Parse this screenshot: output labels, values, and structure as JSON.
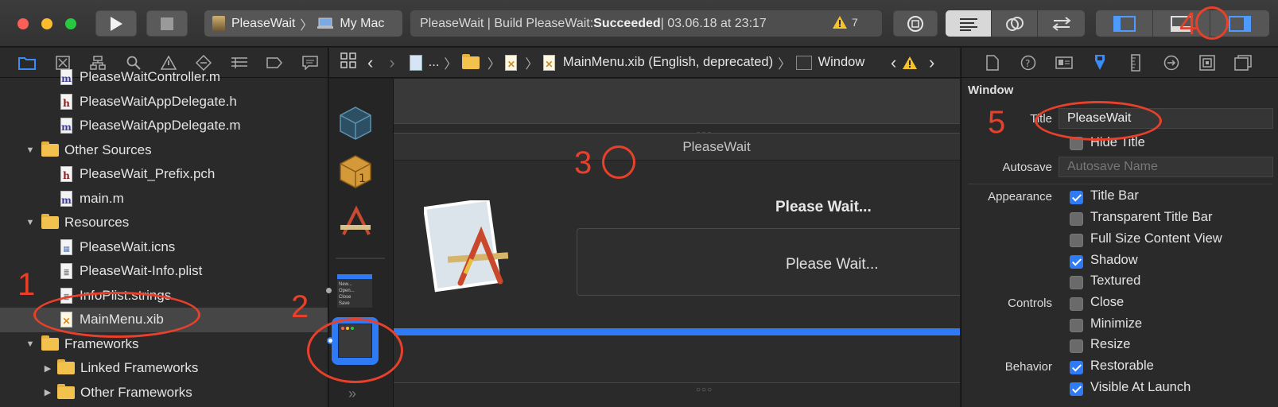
{
  "toolbar": {
    "scheme_target": "PleaseWait",
    "scheme_device": "My Mac",
    "activity_prefix": "PleaseWait | Build PleaseWait: ",
    "activity_status": "Succeeded",
    "activity_time": " | 03.06.18 at 23:17",
    "warning_count": "7"
  },
  "navigator": {
    "tree": [
      {
        "label": "PleaseWaitController.m",
        "type": "m"
      },
      {
        "label": "PleaseWaitAppDelegate.h",
        "type": "h"
      },
      {
        "label": "PleaseWaitAppDelegate.m",
        "type": "m"
      },
      {
        "label": "Other Sources",
        "type": "folder"
      },
      {
        "label": "PleaseWait_Prefix.pch",
        "type": "h"
      },
      {
        "label": "main.m",
        "type": "m"
      },
      {
        "label": "Resources",
        "type": "folder"
      },
      {
        "label": "PleaseWait.icns",
        "type": "file"
      },
      {
        "label": "PleaseWait-Info.plist",
        "type": "file"
      },
      {
        "label": "InfoPlist.strings",
        "type": "file"
      },
      {
        "label": "MainMenu.xib",
        "type": "xib"
      },
      {
        "label": "Frameworks",
        "type": "folder"
      },
      {
        "label": "Linked Frameworks",
        "type": "folder"
      },
      {
        "label": "Other Frameworks",
        "type": "folder"
      }
    ]
  },
  "jumpbar": {
    "ellipsis": "...",
    "file": "MainMenu.xib (English, deprecated)",
    "object": "Window"
  },
  "dock": {
    "menu_items": [
      "New...",
      "Open...",
      "Close",
      "Save"
    ]
  },
  "canvas": {
    "window_title": "PleaseWait",
    "label_bold": "Please Wait...",
    "label_box": "Please Wait..."
  },
  "inspector": {
    "section": "Window",
    "title_label": "Title",
    "title_value": "PleaseWait",
    "hide_title": "Hide Title",
    "autosave_label": "Autosave",
    "autosave_placeholder": "Autosave Name",
    "appearance_label": "Appearance",
    "controls_label": "Controls",
    "behavior_label": "Behavior",
    "options": [
      {
        "label": "Title Bar",
        "checked": true
      },
      {
        "label": "Transparent Title Bar",
        "checked": false
      },
      {
        "label": "Full Size Content View",
        "checked": false
      },
      {
        "label": "Shadow",
        "checked": true
      },
      {
        "label": "Textured",
        "checked": false
      },
      {
        "label": "Close",
        "checked": false
      },
      {
        "label": "Minimize",
        "checked": false
      },
      {
        "label": "Resize",
        "checked": false
      },
      {
        "label": "Restorable",
        "checked": true
      },
      {
        "label": "Visible At Launch",
        "checked": true
      }
    ]
  },
  "annotations": [
    "1",
    "2",
    "3",
    "4",
    "5"
  ],
  "colors": {
    "accent": "#2f7bf5",
    "annotation": "#e8402a",
    "folder": "#f2c14e"
  }
}
